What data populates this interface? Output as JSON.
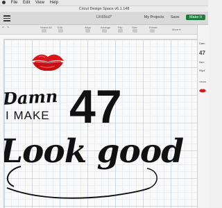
{
  "menubar": {
    "items": [
      "File",
      "Edit",
      "View",
      "Help"
    ]
  },
  "window": {
    "title": "Cricut Design Space  v6.1.148"
  },
  "app": {
    "project_title": "Untitled*",
    "my_projects": "My Projects",
    "save": "Save",
    "make_it": "Make It"
  },
  "toolbar": {
    "select_all": "Select All",
    "edit": "Edit",
    "align": "Align",
    "arrange": "Arrange",
    "flip": "Flip",
    "size": "Size",
    "rotate": "Rotate",
    "more": "More ▾"
  },
  "layers": {
    "items": [
      {
        "label": "Dam"
      },
      {
        "label": "47"
      },
      {
        "label": "Dam"
      },
      {
        "label": "Rfguf"
      },
      {
        "label": "I MAKE"
      }
    ]
  },
  "design": {
    "line1": "Damn",
    "line2": "I MAKE",
    "number": "47",
    "line3": "Look good",
    "lips_color": "#d8171c"
  }
}
